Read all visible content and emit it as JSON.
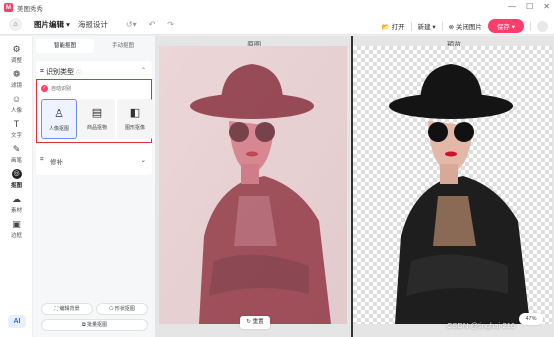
{
  "app": {
    "name": "美图秀秀",
    "logo_text": "M"
  },
  "window_controls": {
    "minimize": "—",
    "maximize": "☐",
    "close": "✕"
  },
  "menubar": {
    "home_icon": "home-icon",
    "tab_active": "图片编辑 ▾",
    "tab_other": "海报设计",
    "open": "打开",
    "new": "新建",
    "close_image": "关闭图片",
    "save": "保存"
  },
  "leftnav": {
    "items": [
      {
        "label": "调整",
        "icon": "⚙"
      },
      {
        "label": "滤镜",
        "icon": "❁"
      },
      {
        "label": "人像",
        "icon": "☺"
      },
      {
        "label": "文字",
        "icon": "T"
      },
      {
        "label": "画笔",
        "icon": "✎"
      },
      {
        "label": "抠图",
        "icon": "◎"
      },
      {
        "label": "素材",
        "icon": "☁"
      },
      {
        "label": "边框",
        "icon": "▣"
      }
    ],
    "ai_label": "AI"
  },
  "panel": {
    "seg_smart": "智能抠图",
    "seg_manual": "手动抠图",
    "recognize_title": "识别类型",
    "auto_recognize": "自动识别",
    "types": [
      {
        "label": "人像抠图",
        "icon": "♙"
      },
      {
        "label": "商品抠物",
        "icon": "▤"
      },
      {
        "label": "图形抠像",
        "icon": "◧"
      }
    ],
    "repair": "修补",
    "btn_edit_bg": "编辑背景",
    "btn_shape": "形状抠图",
    "btn_batch": "批量抠图"
  },
  "canvas": {
    "original_label": "原图",
    "preview_label": "预览",
    "reset": "重置",
    "zoom": "47%",
    "watermark": "CSDN @tinghai-216"
  },
  "colors": {
    "accent": "#ff3d6b",
    "highlight_box": "#e0303a",
    "mask_tint": "#b2304a"
  }
}
